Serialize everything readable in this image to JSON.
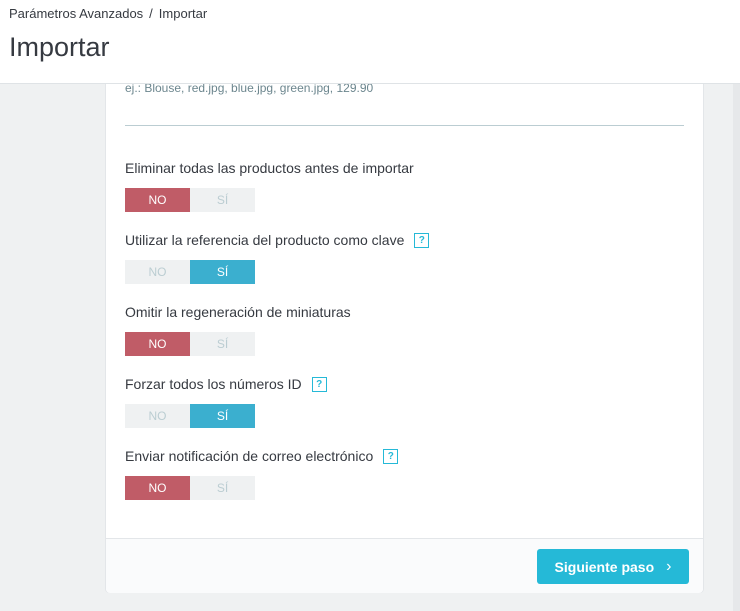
{
  "breadcrumb": {
    "parent": "Parámetros Avanzados",
    "separator": "/",
    "current": "Importar"
  },
  "page": {
    "title": "Importar"
  },
  "form": {
    "hint": "ej.: Blouse, red.jpg, blue.jpg, green.jpg, 129.90",
    "fields": [
      {
        "label": "Eliminar todas las productos antes de importar",
        "has_help": false,
        "no": "NO",
        "yes": "SÍ",
        "selected": "NO"
      },
      {
        "label": "Utilizar la referencia del producto como clave",
        "has_help": true,
        "help": "?",
        "no": "NO",
        "yes": "SÍ",
        "selected": "SÍ"
      },
      {
        "label": "Omitir la regeneración de miniaturas",
        "has_help": false,
        "no": "NO",
        "yes": "SÍ",
        "selected": "NO"
      },
      {
        "label": "Forzar todos los números ID",
        "has_help": true,
        "help": "?",
        "no": "NO",
        "yes": "SÍ",
        "selected": "SÍ"
      },
      {
        "label": "Enviar notificación de correo electrónico",
        "has_help": true,
        "help": "?",
        "no": "NO",
        "yes": "SÍ",
        "selected": "NO"
      }
    ]
  },
  "footer": {
    "next_label": "Siguiente paso",
    "next_icon": "chevron-right-icon",
    "next_glyph": "›"
  },
  "colors": {
    "accent": "#25b9d7",
    "no_active": "#c05c67",
    "yes_active": "#3bafcf"
  }
}
